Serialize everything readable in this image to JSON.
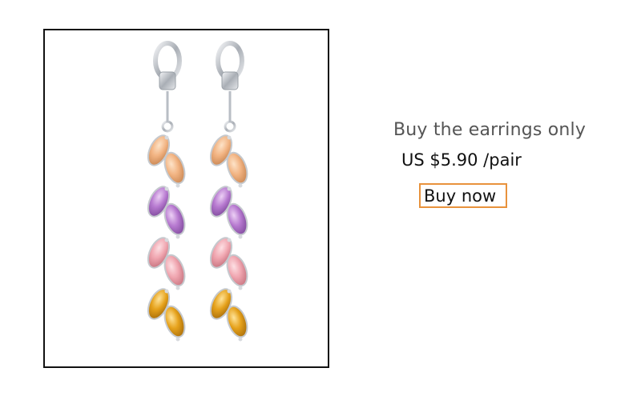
{
  "product": {
    "title": "Buy the earrings only",
    "price": "US $5.90 /pair",
    "buy_label": "Buy now",
    "image": "leaf-drop-earrings-photo"
  },
  "colors": {
    "button_border": "#e8923c",
    "title_text": "#555555",
    "price_text": "#111111",
    "frame_border": "#111111",
    "gem_champagne": "#f2b483",
    "gem_amethyst": "#b77ad0",
    "gem_pink": "#f0a6b0",
    "gem_citrine": "#e6a21c",
    "metal_silver": "#c9cdd2"
  }
}
